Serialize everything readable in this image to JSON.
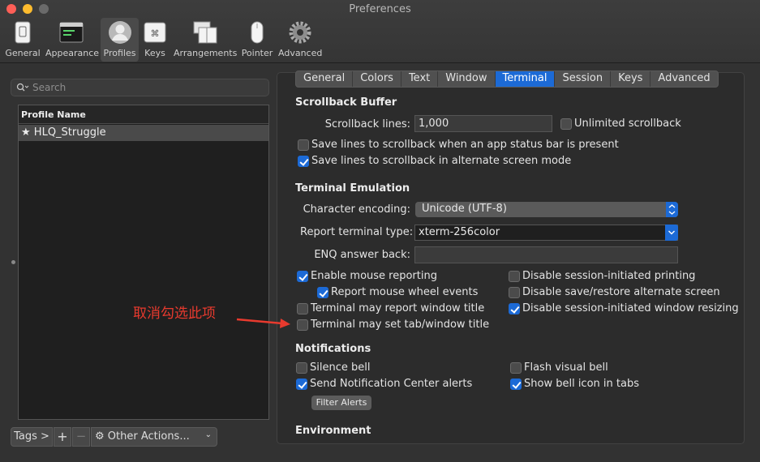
{
  "window": {
    "title": "Preferences"
  },
  "toolbar": [
    {
      "label": "General"
    },
    {
      "label": "Appearance"
    },
    {
      "label": "Profiles"
    },
    {
      "label": "Keys"
    },
    {
      "label": "Arrangements"
    },
    {
      "label": "Pointer"
    },
    {
      "label": "Advanced"
    }
  ],
  "sidebar": {
    "search_placeholder": "Search",
    "list_header": "Profile Name",
    "profiles": [
      {
        "name": "HLQ_Struggle",
        "default": true
      }
    ],
    "tags_button": "Tags >",
    "add_symbol": "+",
    "remove_symbol": "−",
    "other_actions": "Other Actions..."
  },
  "tabs": [
    "General",
    "Colors",
    "Text",
    "Window",
    "Terminal",
    "Session",
    "Keys",
    "Advanced"
  ],
  "active_tab": "Terminal",
  "scrollback": {
    "heading": "Scrollback Buffer",
    "lines_label": "Scrollback lines:",
    "lines_value": "1,000",
    "unlimited": {
      "label": "Unlimited scrollback",
      "checked": false
    },
    "status_bar": {
      "label": "Save lines to scrollback when an app status bar is present",
      "checked": false
    },
    "alternate": {
      "label": "Save lines to scrollback in alternate screen mode",
      "checked": true
    }
  },
  "emulation": {
    "heading": "Terminal Emulation",
    "encoding_label": "Character encoding:",
    "encoding_value": "Unicode (UTF-8)",
    "report_label": "Report terminal type:",
    "report_value": "xterm-256color",
    "enq_label": "ENQ answer back:",
    "enq_value": "",
    "options_left": [
      {
        "label": "Enable mouse reporting",
        "checked": true
      },
      {
        "label": "Report mouse wheel events",
        "checked": true
      },
      {
        "label": "Terminal may report window title",
        "checked": false
      },
      {
        "label": "Terminal may set tab/window title",
        "checked": false
      }
    ],
    "options_right": [
      {
        "label": "Disable session-initiated printing",
        "checked": false
      },
      {
        "label": "Disable save/restore alternate screen",
        "checked": false
      },
      {
        "label": "Disable session-initiated window resizing",
        "checked": true
      }
    ]
  },
  "notifications": {
    "heading": "Notifications",
    "silence_bell": {
      "label": "Silence bell",
      "checked": false
    },
    "flash_bell": {
      "label": "Flash visual bell",
      "checked": false
    },
    "send_alerts": {
      "label": "Send Notification Center alerts",
      "checked": true
    },
    "bell_icon": {
      "label": "Show bell icon in tabs",
      "checked": true
    },
    "filter_button": "Filter Alerts"
  },
  "environment": {
    "heading": "Environment"
  },
  "annotation": {
    "text": "取消勾选此项"
  },
  "colors": {
    "accent": "#1c6ad6",
    "annotation": "#e83a2e"
  }
}
